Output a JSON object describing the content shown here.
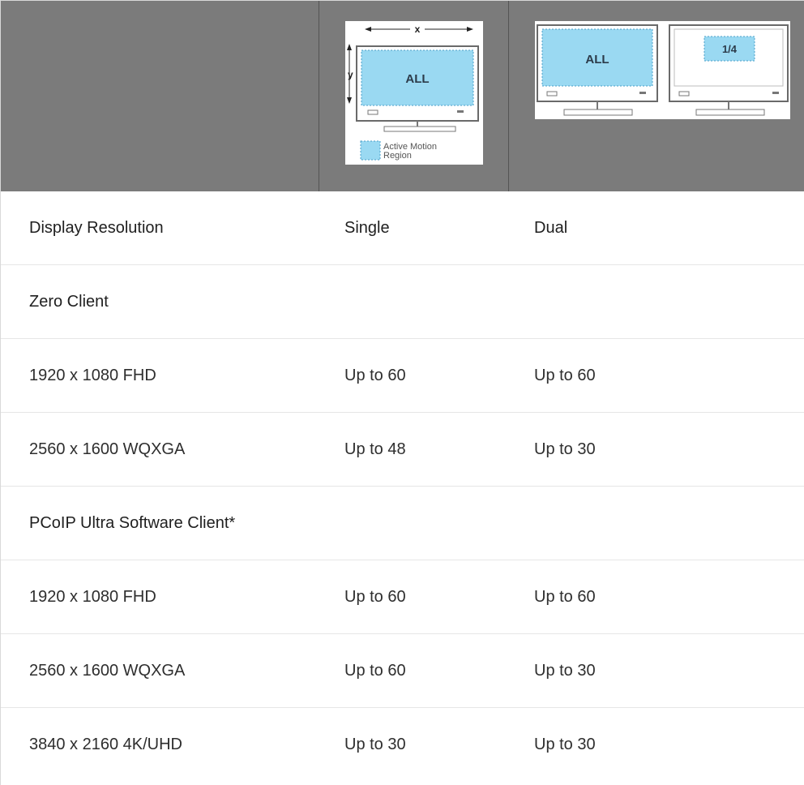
{
  "header": {
    "single_figure": {
      "x_label": "x",
      "y_label": "y",
      "screen_label": "ALL",
      "legend_line1": "Active Motion",
      "legend_line2": "Region"
    },
    "dual_figure": {
      "left_screen_label": "ALL",
      "right_screen_label": "1/4"
    },
    "colors": {
      "header_bg": "#7b7b7b",
      "motion_region": "#9ad9f2"
    }
  },
  "rows": [
    {
      "type": "colhead",
      "cells": [
        "Display Resolution",
        "Single",
        "Dual"
      ]
    },
    {
      "type": "section",
      "cells": [
        "Zero Client",
        "",
        ""
      ]
    },
    {
      "type": "data",
      "cells": [
        "1920 x 1080 FHD",
        "Up to 60",
        "Up to 60"
      ]
    },
    {
      "type": "data",
      "cells": [
        "2560 x 1600 WQXGA",
        "Up to 48",
        "Up to 30"
      ]
    },
    {
      "type": "section",
      "cells": [
        "PCoIP Ultra Software Client*",
        "",
        ""
      ]
    },
    {
      "type": "data",
      "cells": [
        "1920 x 1080 FHD",
        "Up to 60",
        "Up to 60"
      ]
    },
    {
      "type": "data",
      "cells": [
        "2560 x 1600 WQXGA",
        "Up to 60",
        "Up to 30"
      ]
    },
    {
      "type": "data",
      "cells": [
        "3840 x 2160 4K/UHD",
        "Up to 30",
        "Up to 30"
      ]
    }
  ]
}
